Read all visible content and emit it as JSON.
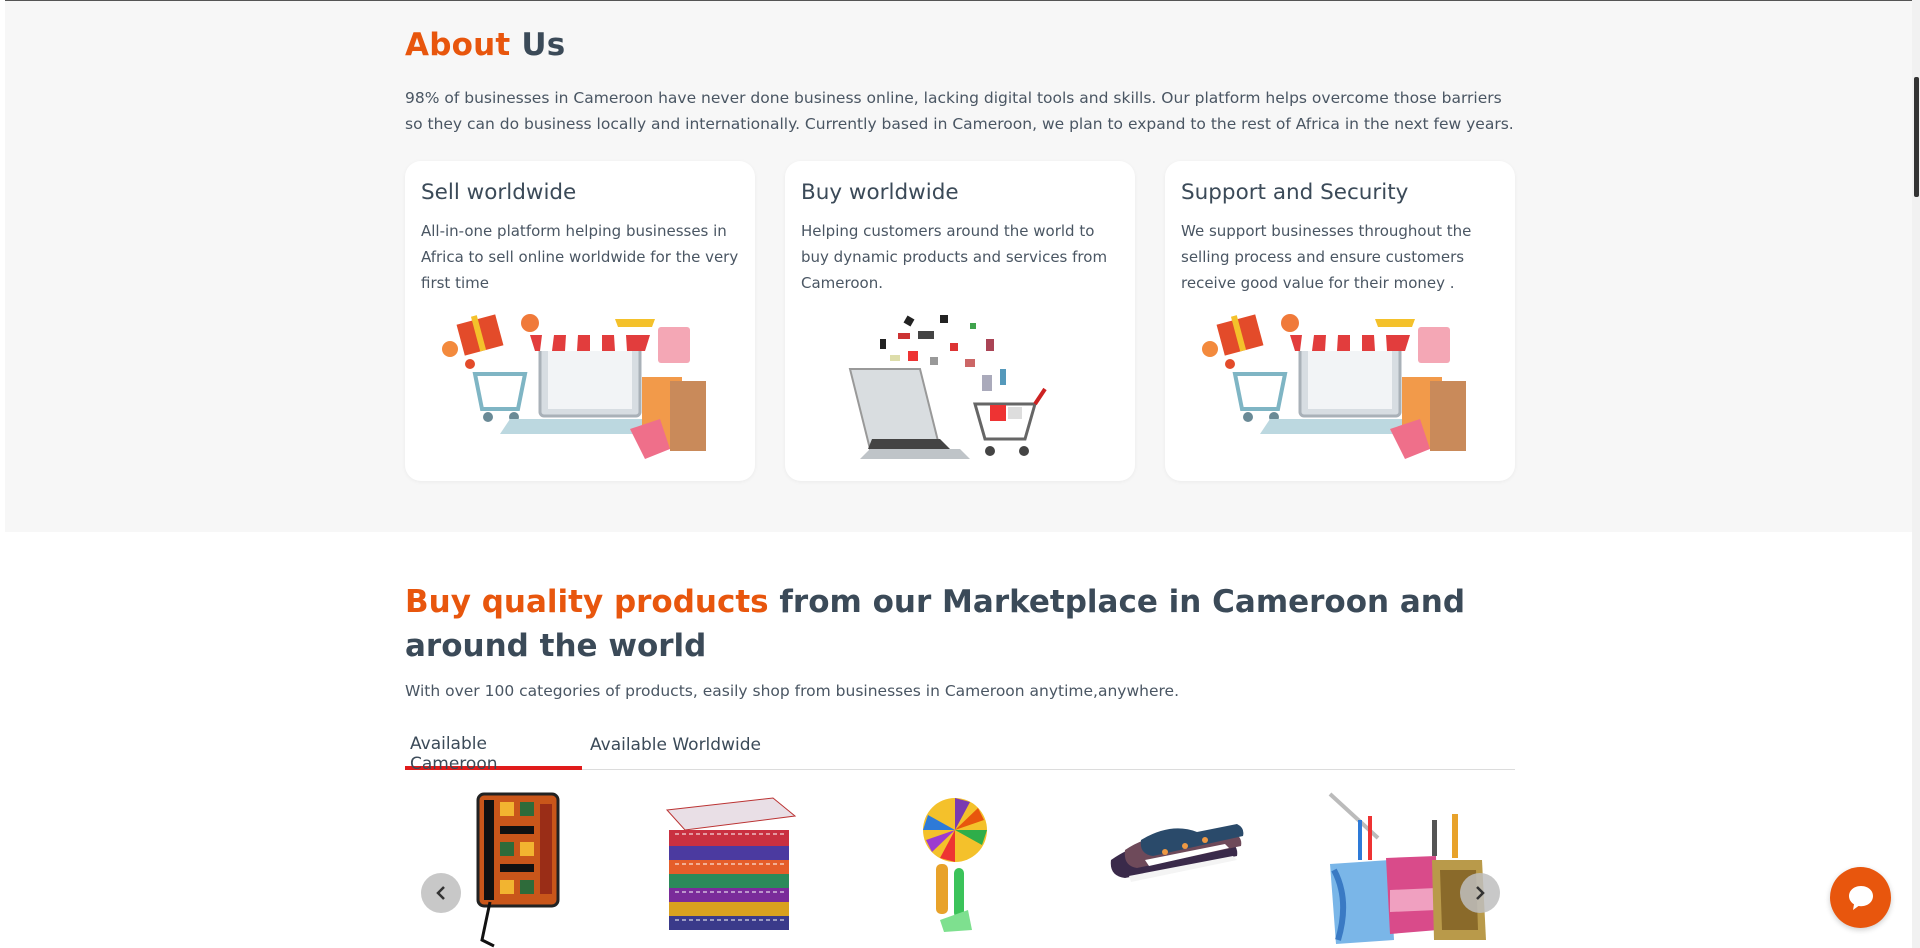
{
  "about": {
    "title_accent": "About",
    "title_rest": "Us",
    "text": "98% of businesses in Cameroon have never done business online, lacking digital tools and skills. Our platform helps overcome those barriers so they can do business locally and internationally. Currently based in Cameroon, we plan to expand to the rest of Africa in the next few years.",
    "cards": [
      {
        "title": "Sell worldwide",
        "text": "All-in-one platform helping businesses in Africa to sell online worldwide for the very first time",
        "image": "online-shop-illustration"
      },
      {
        "title": "Buy worldwide",
        "text": "Helping customers around the world to buy dynamic products and services from Cameroon.",
        "image": "laptop-cart-illustration"
      },
      {
        "title": "Support and Security",
        "text": "We support businesses throughout the selling process and ensure customers receive good value for their money .",
        "image": "online-shop-illustration"
      }
    ]
  },
  "market": {
    "title_accent": "Buy quality products",
    "title_rest": " from our Marketplace in Cameroon and around the world",
    "subtitle": "With over 100 categories of products, easily shop from businesses in Cameroon anytime,anywhere.",
    "tabs": [
      {
        "label": "Available Cameroon",
        "active": true
      },
      {
        "label": "Available Worldwide",
        "active": false
      }
    ],
    "products": [
      {
        "name": "kente-notebook"
      },
      {
        "name": "fabric-stack"
      },
      {
        "name": "colorful-toy"
      },
      {
        "name": "printed-sneakers"
      },
      {
        "name": "pen-holders"
      }
    ]
  },
  "icons": {
    "prev": "chevron-left-icon",
    "next": "chevron-right-icon",
    "chat": "chat-bubble-icon"
  },
  "colors": {
    "accent": "#e8560d",
    "heading": "#3b4a58",
    "tab_active": "#e01b1b"
  }
}
